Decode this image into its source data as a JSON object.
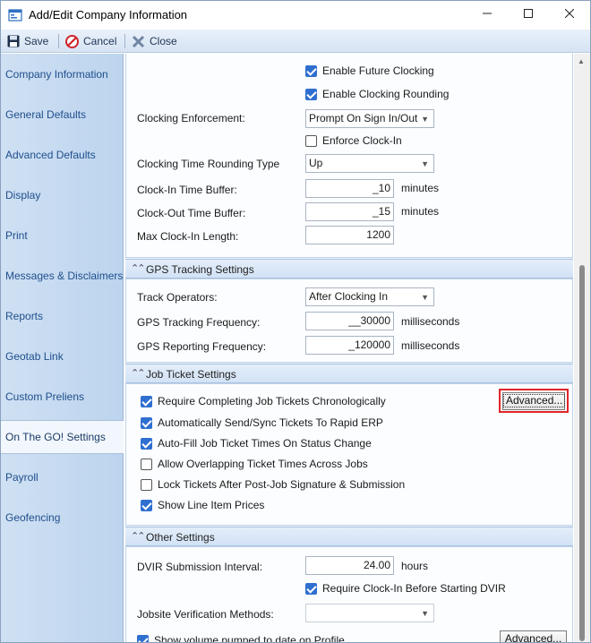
{
  "window": {
    "title": "Add/Edit Company Information"
  },
  "toolbar": {
    "save_label": "Save",
    "cancel_label": "Cancel",
    "close_label": "Close"
  },
  "sidebar": {
    "items": [
      {
        "label": "Company Information"
      },
      {
        "label": "General Defaults"
      },
      {
        "label": "Advanced Defaults"
      },
      {
        "label": "Display"
      },
      {
        "label": "Print"
      },
      {
        "label": "Messages & Disclaimers"
      },
      {
        "label": "Reports"
      },
      {
        "label": "Geotab Link"
      },
      {
        "label": "Custom Preliens"
      },
      {
        "label": "On The GO! Settings",
        "selected": true
      },
      {
        "label": "Payroll"
      },
      {
        "label": "Geofencing"
      }
    ]
  },
  "clocking": {
    "enable_future_clocking": {
      "label": "Enable Future Clocking",
      "checked": true
    },
    "enable_clocking_rounding": {
      "label": "Enable Clocking Rounding",
      "checked": true
    },
    "enforcement_label": "Clocking Enforcement:",
    "enforcement_value": "Prompt On Sign In/Out",
    "enforce_clock_in": {
      "label": "Enforce Clock-In",
      "checked": false
    },
    "rounding_type_label": "Clocking Time Rounding Type",
    "rounding_type_value": "Up",
    "clock_in_buffer_label": "Clock-In Time Buffer:",
    "clock_in_buffer_value": "_10",
    "clock_out_buffer_label": "Clock-Out Time Buffer:",
    "clock_out_buffer_value": "_15",
    "minutes_unit": "minutes",
    "max_clock_in_label": "Max Clock-In Length:",
    "max_clock_in_value": "1200"
  },
  "gps": {
    "section_title": "GPS Tracking Settings",
    "track_operators_label": "Track Operators:",
    "track_operators_value": "After Clocking In",
    "tracking_freq_label": "GPS Tracking Frequency:",
    "tracking_freq_value": "__30000",
    "reporting_freq_label": "GPS Reporting Frequency:",
    "reporting_freq_value": "_120000",
    "ms_unit": "milliseconds"
  },
  "job_ticket": {
    "section_title": "Job Ticket Settings",
    "advanced_label": "Advanced...",
    "options": [
      {
        "label": "Require Completing Job Tickets Chronologically",
        "checked": true
      },
      {
        "label": "Automatically Send/Sync Tickets To Rapid ERP",
        "checked": true
      },
      {
        "label": "Auto-Fill Job Ticket Times On Status Change",
        "checked": true
      },
      {
        "label": "Allow Overlapping Ticket Times Across Jobs",
        "checked": false
      },
      {
        "label": "Lock Tickets After Post-Job Signature & Submission",
        "checked": false
      },
      {
        "label": "Show Line Item Prices",
        "checked": true
      }
    ]
  },
  "other": {
    "section_title": "Other Settings",
    "dvir_interval_label": "DVIR Submission Interval:",
    "dvir_interval_value": "24.00",
    "hours_unit": "hours",
    "require_clock_in_dvir": {
      "label": "Require Clock-In Before Starting DVIR",
      "checked": true
    },
    "jobsite_verification_label": "Jobsite Verification Methods:",
    "jobsite_verification_value": "",
    "show_volume": {
      "label": "Show volume pumped to date on Profile",
      "checked": true
    },
    "advanced_label": "Advanced..."
  },
  "colors": {
    "highlight": "#e0252a",
    "checkbox_on": "#2f6fd0",
    "sidebar_text": "#1f4e8c"
  }
}
